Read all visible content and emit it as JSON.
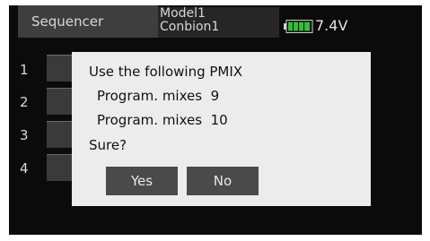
{
  "header": {
    "screen_title": "Sequencer",
    "model_name": "Model1",
    "model_subname": "Conbion1",
    "battery_voltage": "7.4V",
    "battery_level": 1.0
  },
  "rows": [
    {
      "number": "1"
    },
    {
      "number": "2"
    },
    {
      "number": "3"
    },
    {
      "number": "4"
    }
  ],
  "dialog": {
    "line1": "Use the following PMIX",
    "line2": "Program. mixes  9",
    "line3": "Program. mixes  10",
    "line4": "Sure?",
    "yes_label": "Yes",
    "no_label": "No"
  },
  "colors": {
    "background": "#0b0b0b",
    "dialog_bg": "#ececec",
    "battery_green": "#2fc12f"
  }
}
